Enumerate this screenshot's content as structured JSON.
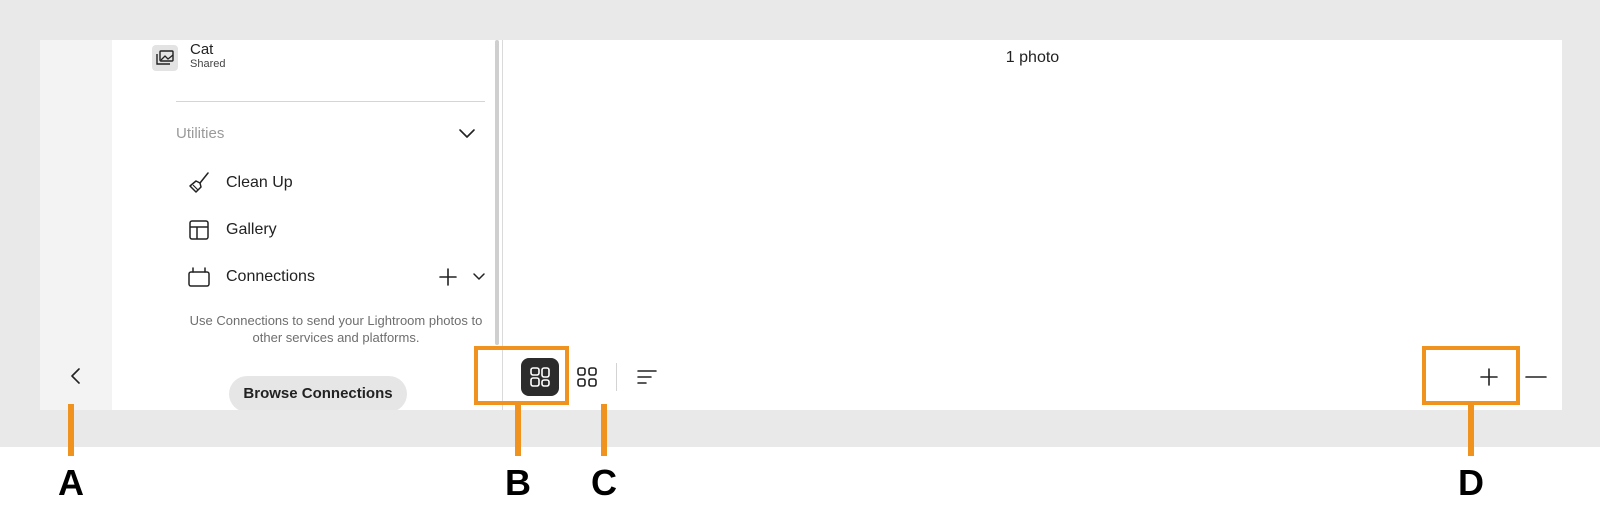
{
  "sidebar": {
    "album": {
      "name": "Cat",
      "status": "Shared",
      "icon": "photo-album-icon"
    },
    "utilities": {
      "title": "Utilities",
      "items": [
        {
          "label": "Clean Up",
          "icon": "broom-icon"
        },
        {
          "label": "Gallery",
          "icon": "gallery-layout-icon"
        },
        {
          "label": "Connections",
          "icon": "connections-icon"
        }
      ],
      "connections_description": "Use Connections to send your Lightroom photos to other services and platforms.",
      "browse_button": "Browse Connections"
    }
  },
  "main": {
    "photo_count": "1 photo"
  },
  "toolbar": {
    "view_modes": [
      "square-grid-view",
      "photo-grid-view"
    ],
    "active_view": "square-grid-view",
    "sort_icon": "sort-icon",
    "zoom": [
      "zoom-in-icon",
      "zoom-out-icon"
    ]
  },
  "callouts": [
    "A",
    "B",
    "C",
    "D"
  ],
  "colors": {
    "callout": "#f0921e",
    "outer_background": "#e9e9e9",
    "rail": "#f3f3f3",
    "active_toggle": "#2c2c2c"
  }
}
